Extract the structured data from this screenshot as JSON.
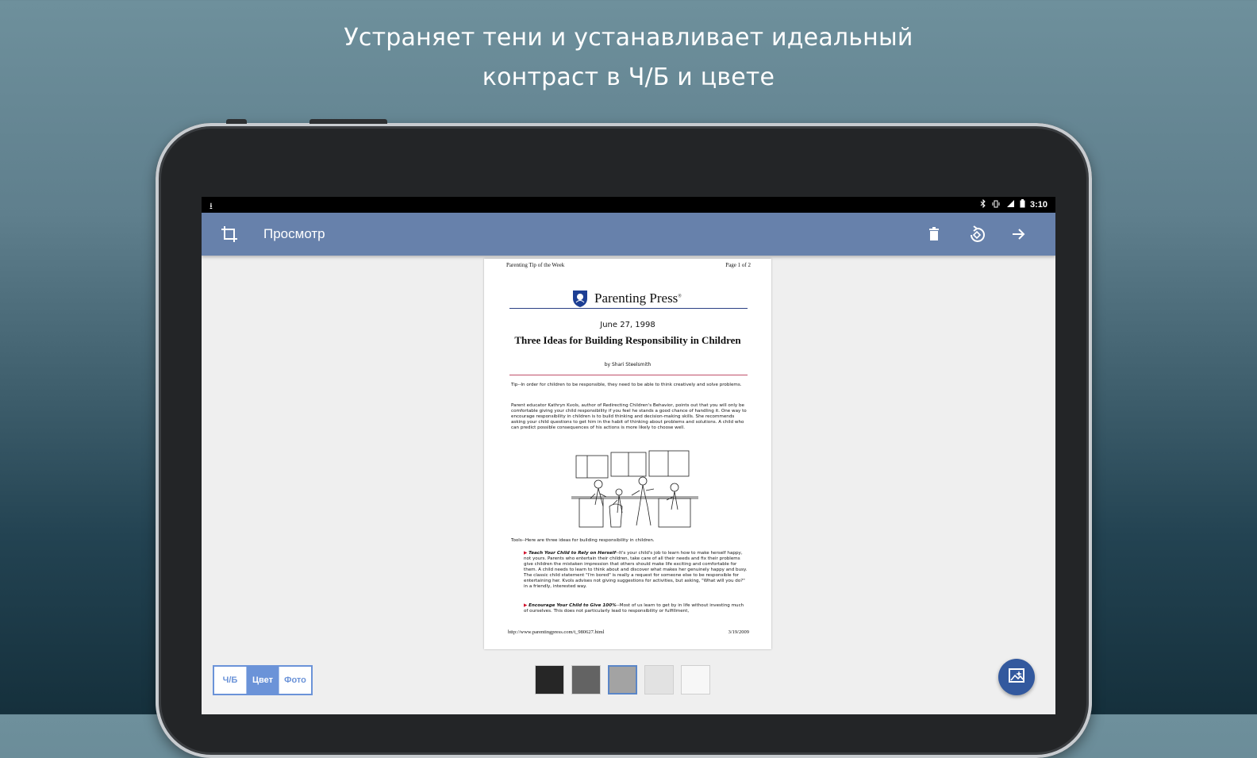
{
  "promo": {
    "line1": "Устраняет тени и устанавливает идеальный",
    "line2": "контраст в Ч/Б и цвете"
  },
  "status_bar": {
    "left_icon": "download-icon",
    "icons": [
      "bluetooth-icon",
      "vibrate-icon",
      "signal-3g-icon",
      "battery-icon"
    ],
    "time": "3:10"
  },
  "toolbar": {
    "title": "Просмотр",
    "crop_icon": "crop-icon",
    "actions": [
      "delete-icon",
      "rotate-icon",
      "arrow-forward-icon"
    ]
  },
  "document": {
    "header_left": "Parenting Tip of the Week",
    "header_right": "Page 1 of 2",
    "brand": "Parenting Press",
    "brand_mark": "®",
    "date": "June 27, 1998",
    "headline": "Three Ideas for Building Responsibility in Children",
    "byline": "by Shari Steelsmith",
    "tip": "Tip--In order for children to be responsible, they need to be able to think creatively and solve problems.",
    "para1": "Parent educator Kathryn Kvols, author of Redirecting Children's Behavior, points out that you will only be comfortable giving your child responsibility if you feel he stands a good chance of handling it. One way to encourage responsibility in children is to build thinking and decision-making skills. She recommends asking your child questions to get him in the habit of thinking about problems and solutions. A child who can predict possible consequences of his actions is more likely to choose well.",
    "tools": "Tools--Here are three ideas for building responsibility in children.",
    "item1_title": "Teach Your Child to Rely on Herself",
    "item1_text": "--It's your child's job to learn how to make herself happy, not yours. Parents who entertain their children, take care of all their needs and fix their problems give children the mistaken impression that others should make life exciting and comfortable for them. A child needs to learn to think about and discover what makes her genuinely happy and busy. The classic child statement \"I'm bored\" is really a request for someone else to be responsible for entertaining her. Kvols advises not giving suggestions for activities, but asking, \"What will you do?\" in a friendly, interested way.",
    "item2_title": "Encourage Your Child to Give 100%",
    "item2_text": "--Most of us learn to get by in life without investing much of ourselves. This does not particularly lead to responsibility or fulfillment,",
    "footer_left": "http://www.parentingpress.com/t_980627.html",
    "footer_right": "3/19/2009"
  },
  "modes": {
    "items": [
      "Ч/Б",
      "Цвет",
      "Фото"
    ],
    "selected": "Цвет"
  },
  "swatches": {
    "colors": [
      "#262626",
      "#636363",
      "#a3a3a3",
      "#e2e2e2",
      "#f7f7f7"
    ],
    "selected_index": 2,
    "selected_border": "#5a86c8"
  },
  "fab": {
    "icon": "image-enhance-icon"
  },
  "colors": {
    "appbar": "#6781ab",
    "accent": "#6b93d8",
    "fab": "#33599e"
  }
}
